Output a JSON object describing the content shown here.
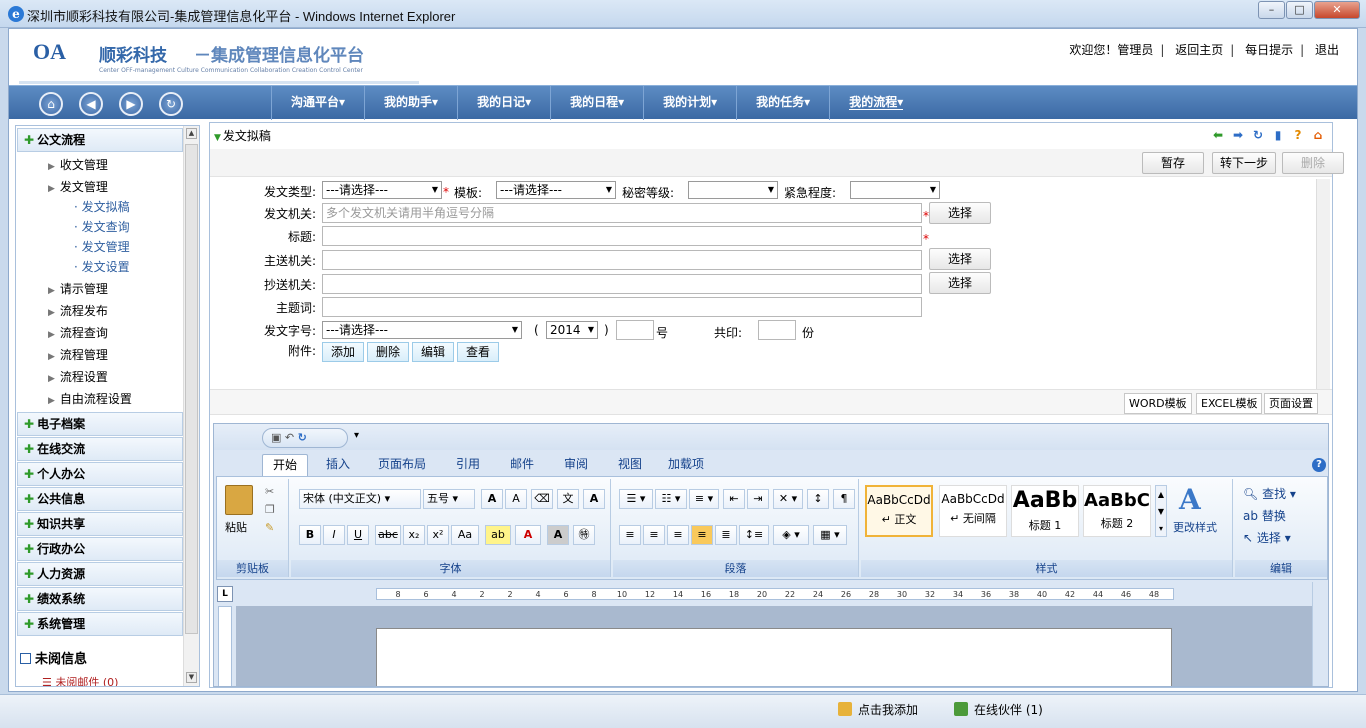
{
  "window": {
    "title": "深圳市顺彩科技有限公司-集成管理信息化平台 - Windows Internet Explorer",
    "minimize": "–",
    "maximize": "□",
    "close": "✕"
  },
  "header": {
    "logo": "OA",
    "company": "顺彩科技",
    "platform": "－集成管理信息化平台",
    "tagline": "Center OFF-management   Culture Communication Collaboration Creation Control Center",
    "welcome": "欢迎您！管理员",
    "links": [
      "返回主页",
      "每日提示",
      "退出"
    ]
  },
  "nav": {
    "menu": [
      "沟通平台▾",
      "我的助手▾",
      "我的日记▾",
      "我的日程▾",
      "我的计划▾",
      "我的任务▾",
      "我的流程▾"
    ]
  },
  "sidebar": {
    "group_main": "公文流程",
    "items": [
      "收文管理",
      "发文管理",
      "请示管理",
      "流程发布",
      "流程查询",
      "流程管理",
      "流程设置",
      "自由流程设置"
    ],
    "subitems": [
      "· 发文拟稿",
      "· 发文查询",
      "· 发文管理",
      "· 发文设置"
    ],
    "groups": [
      "电子档案",
      "在线交流",
      "个人办公",
      "公共信息",
      "知识共享",
      "行政办公",
      "人力资源",
      "绩效系统",
      "系统管理"
    ],
    "unread_title": "未阅信息",
    "unread_mail": "未阅邮件 (0)"
  },
  "main": {
    "title": "发文拟稿",
    "buttons": {
      "save": "暂存",
      "next": "转下一步",
      "delete": "删除"
    },
    "form": {
      "doc_type_label": "发文类型:",
      "doc_type_value": "---请选择---",
      "template_label": "模板:",
      "template_value": "---请选择---",
      "secret_label": "秘密等级:",
      "urgency_label": "紧急程度:",
      "org_label": "发文机关:",
      "org_placeholder": "多个发文机关请用半角逗号分隔",
      "subject_label": "标题:",
      "main_send_label": "主送机关:",
      "cc_label": "抄送机关:",
      "keyword_label": "主题词:",
      "doc_no_label": "发文字号:",
      "doc_no_value": "---请选择---",
      "paren_open": "(",
      "year": "2014",
      "paren_close": ")",
      "hao": "号",
      "print_label": "共印:",
      "fen": "份",
      "attach_label": "附件:",
      "choose": "选择",
      "attach_buttons": [
        "添加",
        "删除",
        "编辑",
        "查看"
      ]
    },
    "templates": [
      "WORD模板",
      "EXCEL模板",
      "页面设置"
    ]
  },
  "word": {
    "tabs": [
      "开始",
      "插入",
      "页面布局",
      "引用",
      "邮件",
      "审阅",
      "视图",
      "加载项"
    ],
    "groups": {
      "clipboard": "剪贴板",
      "font": "字体",
      "paragraph": "段落",
      "styles": "样式",
      "editing": "编辑"
    },
    "paste": "粘贴",
    "font_name": "宋体 (中文正文)",
    "font_size": "五号",
    "styles": [
      {
        "sample": "AaBbCcDd",
        "name": "↵ 正文"
      },
      {
        "sample": "AaBbCcDd",
        "name": "↵ 无间隔"
      },
      {
        "sample": "AaBb",
        "name": "标题 1"
      },
      {
        "sample": "AaBbC",
        "name": "标题 2"
      }
    ],
    "change_styles": "更改样式",
    "edit_buttons": [
      "查找 ▾",
      "替换",
      "选择 ▾"
    ],
    "ruler_ticks": [
      "8",
      "6",
      "4",
      "2",
      "2",
      "4",
      "6",
      "8",
      "10",
      "12",
      "14",
      "16",
      "18",
      "20",
      "22",
      "24",
      "26",
      "28",
      "30",
      "32",
      "34",
      "36",
      "38",
      "40",
      "42",
      "44",
      "46",
      "48"
    ],
    "font_buttons": [
      "B",
      "I",
      "U",
      "abc",
      "x₂",
      "x²",
      "Aa",
      "ab",
      "A",
      "A",
      "㊕"
    ]
  },
  "status": {
    "add_me": "点击我添加",
    "online": "在线伙伴 (1)"
  },
  "colors": {
    "nav": "#3b69a4",
    "accent": "#2a5fa5",
    "plus": "#2f9a2a"
  }
}
